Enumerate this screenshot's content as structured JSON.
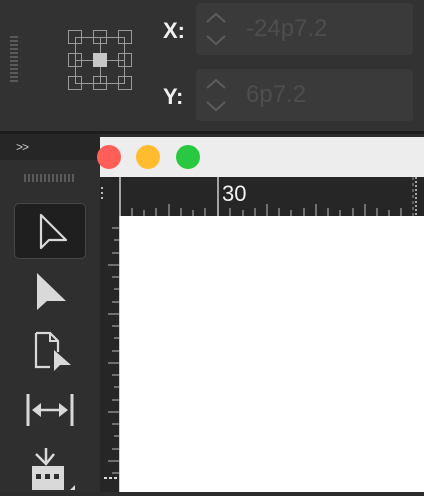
{
  "control_bar": {
    "reference_point": "center",
    "x_label": "X:",
    "y_label": "Y:",
    "x_value": "-24p7.2",
    "y_value": "6p7.2"
  },
  "tools_panel": {
    "collapse_label": ">>",
    "tools": [
      {
        "name": "selection-tool",
        "icon": "arrow-outline-icon",
        "active": true
      },
      {
        "name": "direct-selection-tool",
        "icon": "arrow-filled-icon",
        "active": false
      },
      {
        "name": "page-tool",
        "icon": "page-arrow-icon",
        "active": false
      },
      {
        "name": "gap-tool",
        "icon": "gap-arrows-icon",
        "active": false
      },
      {
        "name": "content-collector-tool",
        "icon": "content-collector-icon",
        "active": false
      }
    ]
  },
  "document_window": {
    "traffic_lights": [
      "#ff5f57",
      "#febc2e",
      "#28c840"
    ],
    "ruler_label": "30"
  },
  "colors": {
    "panel_bg": "#323232",
    "field_bg": "#3a3a3a",
    "canvas": "#ffffff"
  }
}
